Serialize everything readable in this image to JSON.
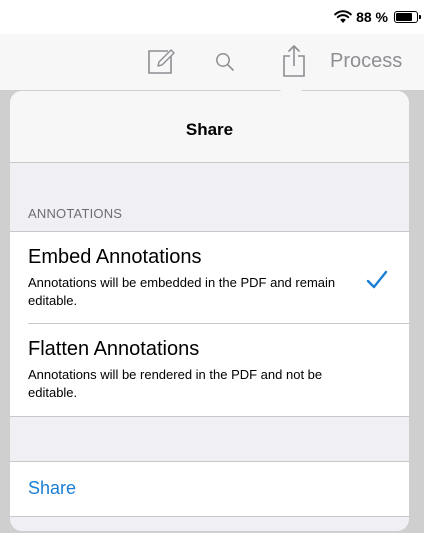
{
  "status_bar": {
    "battery_text": "88 %",
    "battery_level": 0.88,
    "wifi_icon": "wifi-icon",
    "battery_icon": "battery-icon"
  },
  "toolbar": {
    "edit_icon": "edit-icon",
    "search_icon": "search-icon",
    "share_icon": "share-icon",
    "process_label": "Process"
  },
  "popover": {
    "title": "Share",
    "section_header": "ANNOTATIONS",
    "options": [
      {
        "title": "Embed Annotations",
        "description": "Annotations will be embedded in the PDF and remain editable.",
        "selected": true
      },
      {
        "title": "Flatten Annotations",
        "description": "Annotations will be rendered in the PDF and not be editable.",
        "selected": false
      }
    ],
    "share_action_label": "Share"
  },
  "colors": {
    "accent": "#1a7fd4",
    "icon_gray": "#8e8e93",
    "separator": "#c8c7cc",
    "grouped_background": "#efeff4"
  }
}
